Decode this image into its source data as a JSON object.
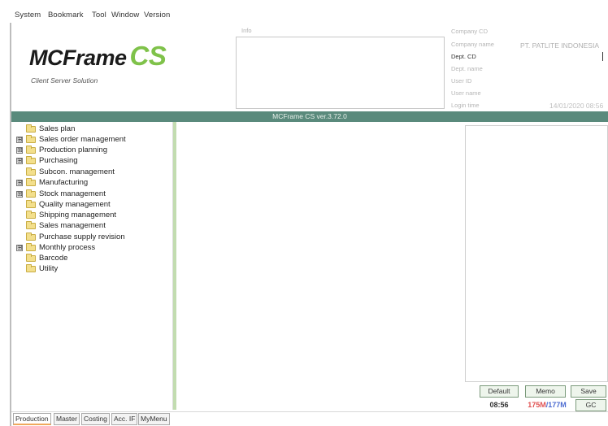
{
  "menu": {
    "items": [
      {
        "label": "System"
      },
      {
        "label": "Bookmark"
      },
      {
        "label": "Tool"
      },
      {
        "label": "Window"
      },
      {
        "label": "Version"
      }
    ]
  },
  "header": {
    "logo_main": "MCFrame",
    "logo_accent": "CS",
    "tagline": "Client Server Solution",
    "info_label": "Info",
    "fields": {
      "company_cd": "Company CD",
      "company_name": "Company name",
      "dept_cd": "Dept. CD",
      "dept_name": "Dept. name",
      "user_id": "User ID",
      "user_name": "User name",
      "login_time": "Login time"
    },
    "company_name_value": "PT. PATLITE INDONESIA",
    "login_time_value": "14/01/2020 08:56"
  },
  "title_bar": {
    "text": "MCFrame CS ver.3.72.0"
  },
  "tree": {
    "items": [
      {
        "label": "Sales plan",
        "expandable": false
      },
      {
        "label": "Sales order management",
        "expandable": true
      },
      {
        "label": "Production planning",
        "expandable": true
      },
      {
        "label": "Purchasing",
        "expandable": true
      },
      {
        "label": "Subcon. management",
        "expandable": false
      },
      {
        "label": "Manufacturing",
        "expandable": true
      },
      {
        "label": "Stock management",
        "expandable": true
      },
      {
        "label": "Quality management",
        "expandable": false
      },
      {
        "label": "Shipping management",
        "expandable": false
      },
      {
        "label": "Sales management",
        "expandable": false
      },
      {
        "label": "Purchase supply revision",
        "expandable": false
      },
      {
        "label": "Monthly process",
        "expandable": true
      },
      {
        "label": "Barcode",
        "expandable": false
      },
      {
        "label": "Utility",
        "expandable": false
      }
    ],
    "expand_glyph": "⊞"
  },
  "buttons": {
    "default": "Default",
    "memo": "Memo",
    "save": "Save",
    "gc": "GC"
  },
  "status": {
    "time": "08:56",
    "mem_used": "175M",
    "mem_sep": "/",
    "mem_total": "177M"
  },
  "tabs": [
    {
      "label": "Production",
      "active": true
    },
    {
      "label": "Master",
      "active": false
    },
    {
      "label": "Costing",
      "active": false
    },
    {
      "label": "Acc. IF",
      "active": false
    },
    {
      "label": "MyMenu",
      "active": false
    }
  ],
  "colors": {
    "title_bar": "#5a8a7c",
    "logo_accent": "#7fc24a",
    "mem_used": "#e05050",
    "mem_total": "#4a6ad0"
  }
}
